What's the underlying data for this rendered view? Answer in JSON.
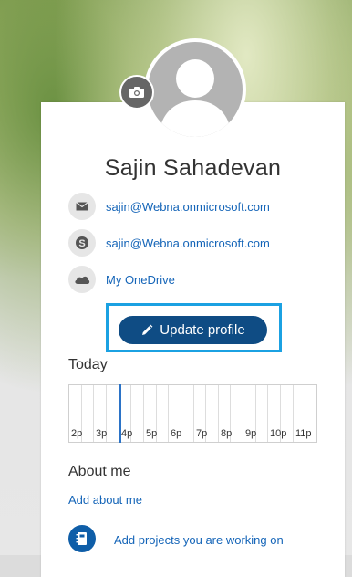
{
  "profile": {
    "name": "Sajin Sahadevan",
    "email": "sajin@Webna.onmicrosoft.com",
    "skype": "sajin@Webna.onmicrosoft.com",
    "onedrive_label": "My OneDrive",
    "update_label": "Update profile"
  },
  "today": {
    "title": "Today",
    "hours": [
      "2p",
      "3p",
      "4p",
      "5p",
      "6p",
      "7p",
      "8p",
      "9p",
      "10p",
      "11p"
    ]
  },
  "about": {
    "title": "About me",
    "add_label": "Add about me"
  },
  "projects": {
    "add_label": "Add projects you are working on"
  },
  "colors": {
    "accent": "#0f4c84",
    "link": "#1565b8",
    "highlight_frame": "#1ba1e2",
    "now_line": "#2b73c7"
  },
  "icons": [
    "camera-icon",
    "mail-icon",
    "skype-icon",
    "onedrive-icon",
    "pencil-icon",
    "notebook-icon"
  ]
}
